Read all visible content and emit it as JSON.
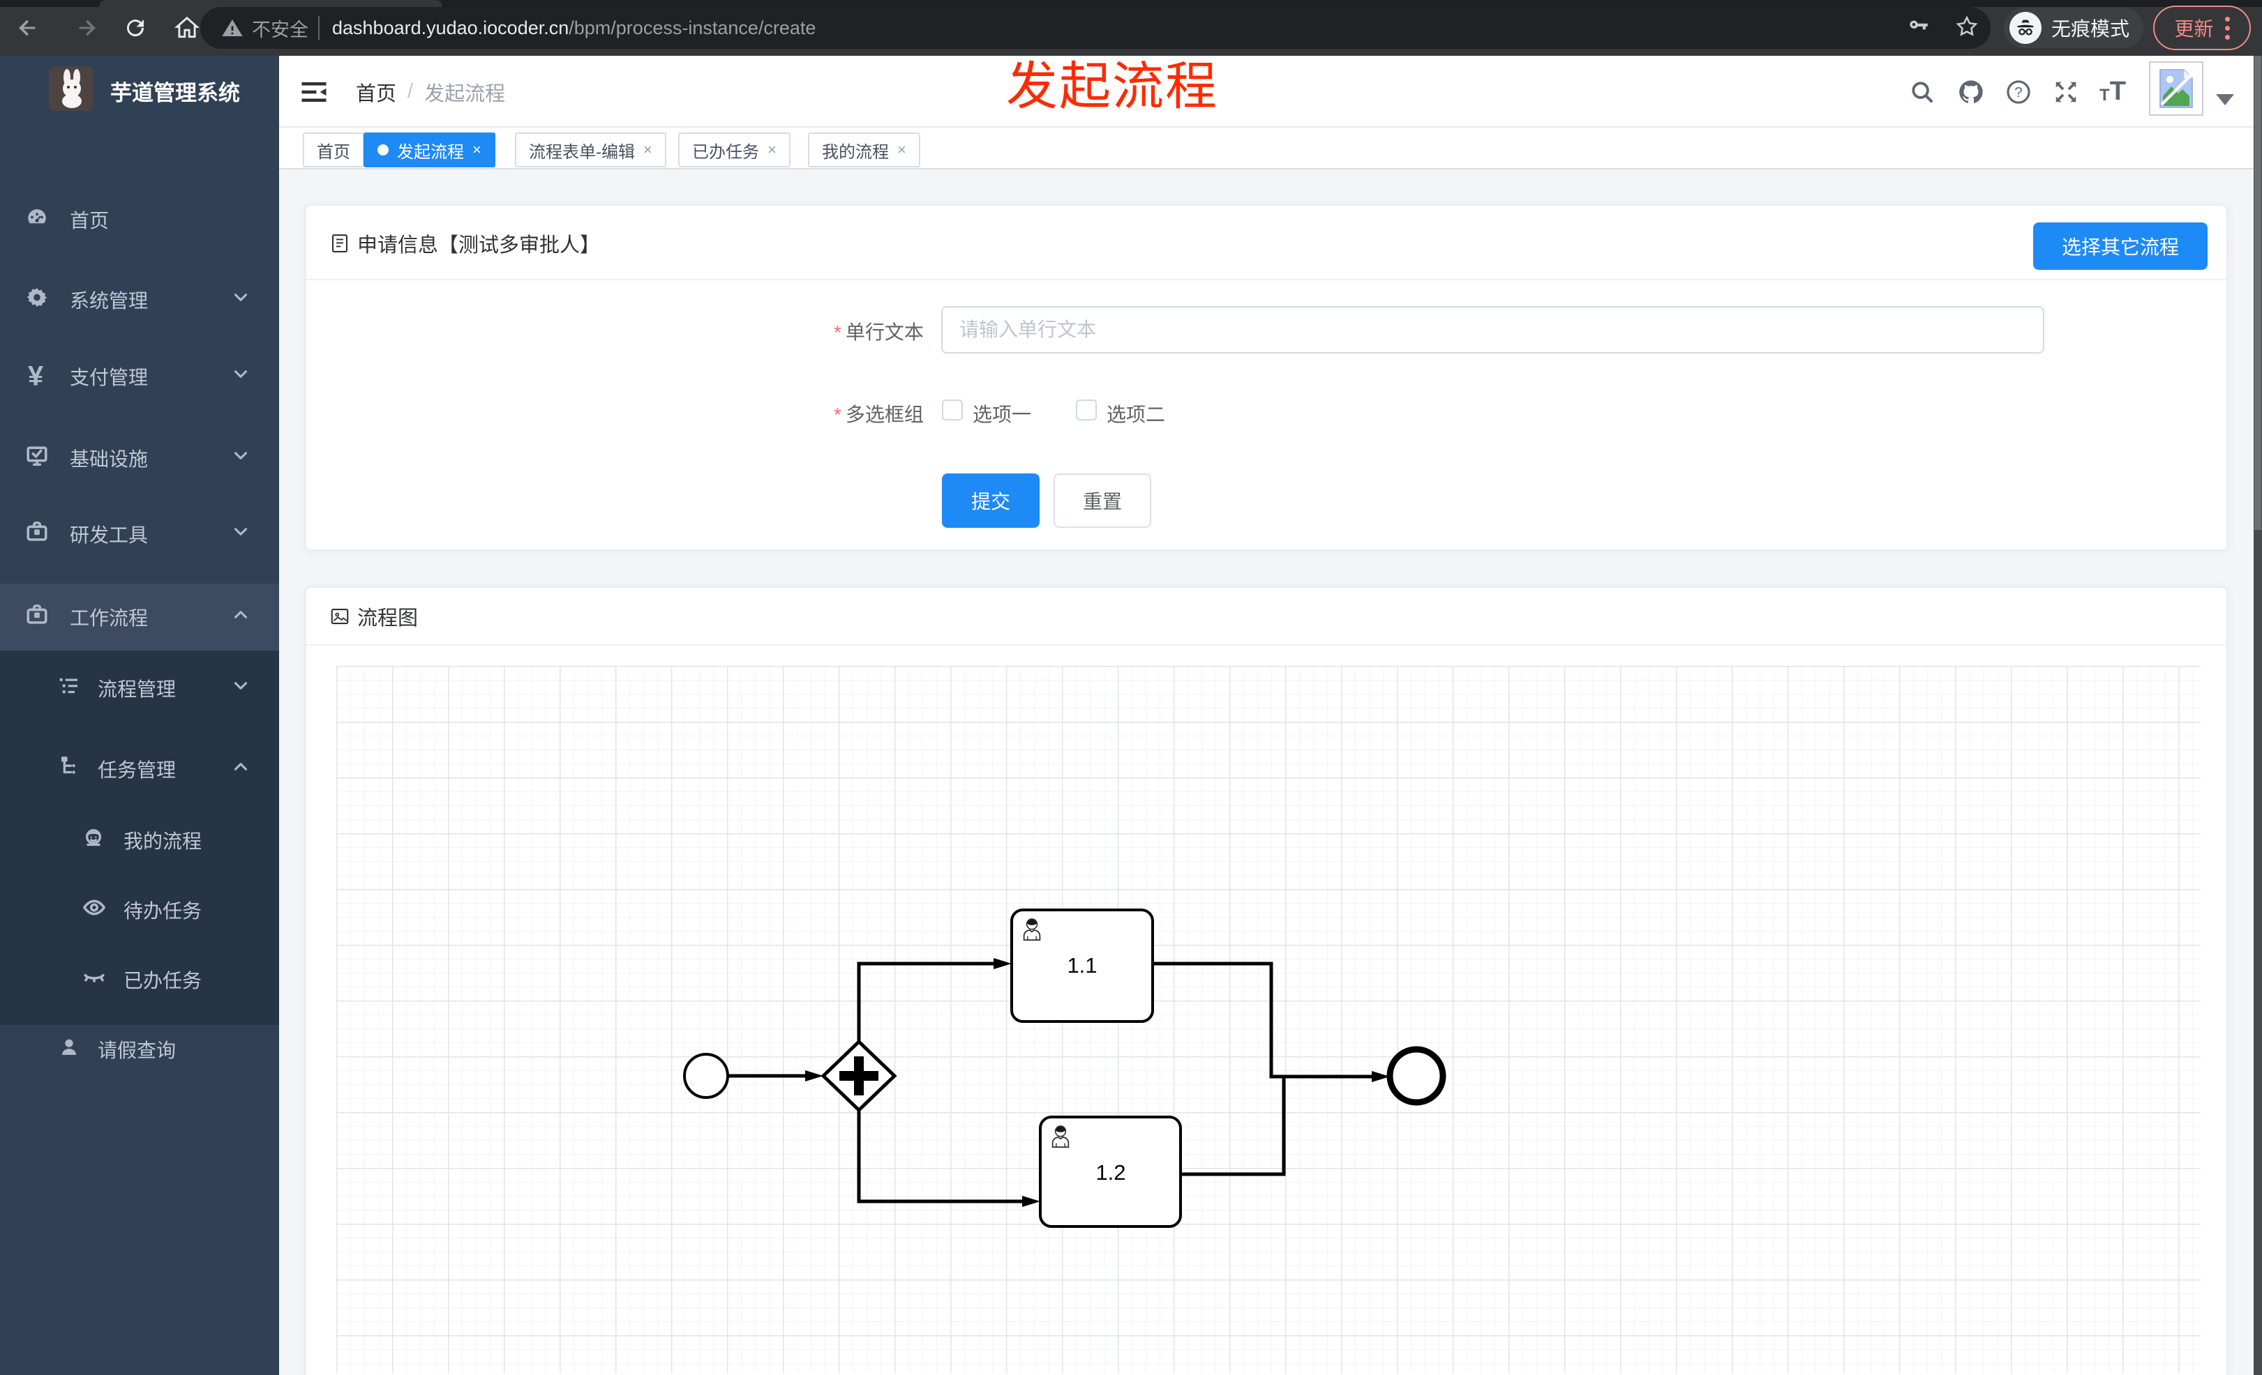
{
  "browser": {
    "security_label": "不安全",
    "url_domain": "dashboard.yudao.iocoder.cn",
    "url_path": "/bpm/process-instance/create",
    "incognito_label": "无痕模式",
    "update_label": "更新",
    "icons": [
      "back-icon",
      "forward-icon",
      "reload-icon",
      "home-icon",
      "warning-icon",
      "key-icon",
      "star-icon",
      "incognito-icon",
      "kebab-menu-icon"
    ]
  },
  "sidebar": {
    "app_title": "芋道管理系统",
    "items": [
      {
        "label": "首页",
        "icon": "dashboard-icon",
        "chevron": ""
      },
      {
        "label": "系统管理",
        "icon": "gear-icon",
        "chevron": "down"
      },
      {
        "label": "支付管理",
        "icon": "yen-icon",
        "chevron": "down"
      },
      {
        "label": "基础设施",
        "icon": "monitor-icon",
        "chevron": "down"
      },
      {
        "label": "研发工具",
        "icon": "briefcase-icon",
        "chevron": "down"
      },
      {
        "label": "工作流程",
        "icon": "briefcase-icon",
        "chevron": "up",
        "expanded": true
      }
    ],
    "submenu": [
      {
        "label": "流程管理",
        "icon": "list-icon",
        "chevron": "down"
      },
      {
        "label": "任务管理",
        "icon": "tree-icon",
        "chevron": "up"
      },
      {
        "label": "我的流程",
        "icon": "face-icon",
        "chevron": ""
      },
      {
        "label": "待办任务",
        "icon": "eye-open-icon",
        "chevron": ""
      },
      {
        "label": "已办任务",
        "icon": "eye-closed-icon",
        "chevron": ""
      },
      {
        "label": "请假查询",
        "icon": "user-icon",
        "chevron": ""
      }
    ]
  },
  "header": {
    "breadcrumb": [
      "首页",
      "发起流程"
    ],
    "separator": "/",
    "icons": [
      "search-icon",
      "github-icon",
      "help-icon",
      "fullscreen-icon",
      "font-size-icon",
      "avatar",
      "caret-down-icon"
    ]
  },
  "tabs": [
    {
      "label": "首页",
      "active": false,
      "closable": false
    },
    {
      "label": "发起流程",
      "active": true,
      "closable": true
    },
    {
      "label": "流程表单-编辑",
      "active": false,
      "closable": true
    },
    {
      "label": "已办任务",
      "active": false,
      "closable": true
    },
    {
      "label": "我的流程",
      "active": false,
      "closable": true
    }
  ],
  "close_glyph": "×",
  "annotation": {
    "text": "发起流程",
    "color": "#ff2a00"
  },
  "apply_card": {
    "title": "申请信息【测试多审批人】",
    "choose_button": "选择其它流程",
    "fields": [
      {
        "label": "单行文本",
        "required": true,
        "placeholder": "请输入单行文本",
        "value": ""
      },
      {
        "label": "多选框组",
        "required": true,
        "options": [
          "选项一",
          "选项二"
        ],
        "checked": [
          false,
          false
        ]
      }
    ],
    "submit": "提交",
    "reset": "重置"
  },
  "diagram_card": {
    "title": "流程图",
    "type": "bpmn",
    "nodes": [
      {
        "id": "start",
        "kind": "start-event"
      },
      {
        "id": "gateway",
        "kind": "parallel-gateway"
      },
      {
        "id": "task1",
        "kind": "user-task",
        "label": "1.1"
      },
      {
        "id": "task2",
        "kind": "user-task",
        "label": "1.2"
      },
      {
        "id": "end",
        "kind": "end-event"
      }
    ],
    "edges": [
      "start→gateway",
      "gateway→task1",
      "gateway→task2",
      "task1→end",
      "task2→end"
    ]
  },
  "colors": {
    "primary": "#1e8af6",
    "sidebar": "#304156",
    "submenu": "#263546",
    "annotation": "#ff2a00"
  }
}
